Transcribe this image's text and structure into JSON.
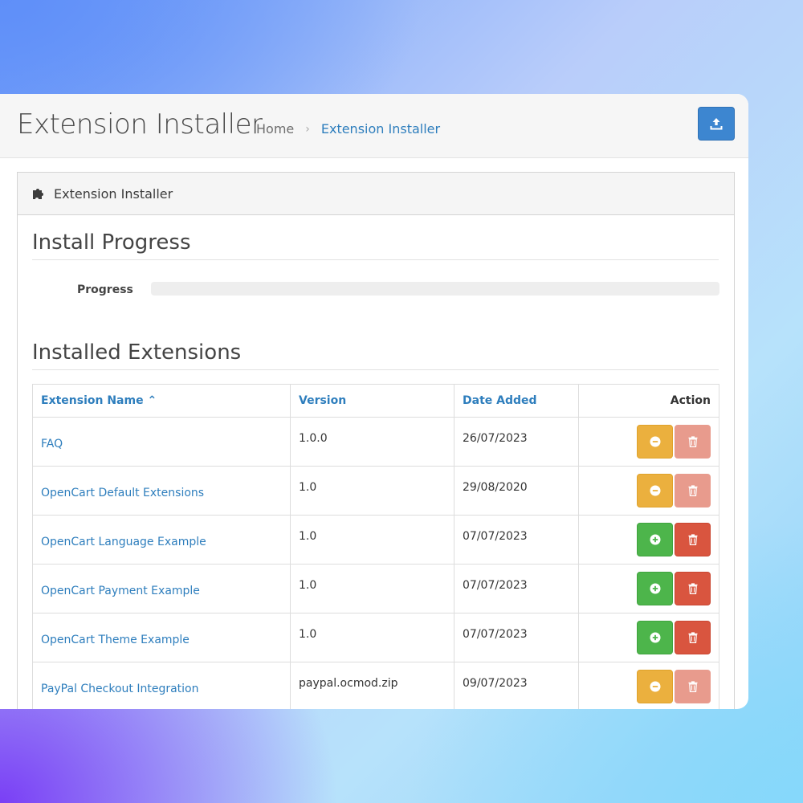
{
  "page": {
    "title": "Extension Installer",
    "breadcrumb": [
      {
        "label": "Home"
      },
      {
        "label": "Extension Installer"
      }
    ],
    "upload_icon": "upload-icon"
  },
  "panel": {
    "heading": "Extension Installer",
    "heading_icon": "puzzle-piece-icon"
  },
  "progress": {
    "section_title": "Install Progress",
    "label": "Progress",
    "value_percent": 0
  },
  "installed": {
    "section_title": "Installed Extensions",
    "columns": {
      "name": "Extension Name",
      "version": "Version",
      "date": "Date Added",
      "action": "Action"
    },
    "rows": [
      {
        "name": "FAQ",
        "version": "1.0.0",
        "date": "26/07/2023",
        "installed": true,
        "deletable": false
      },
      {
        "name": "OpenCart Default Extensions",
        "version": "1.0",
        "date": "29/08/2020",
        "installed": true,
        "deletable": false
      },
      {
        "name": "OpenCart Language Example",
        "version": "1.0",
        "date": "07/07/2023",
        "installed": false,
        "deletable": true
      },
      {
        "name": "OpenCart Payment Example",
        "version": "1.0",
        "date": "07/07/2023",
        "installed": false,
        "deletable": true
      },
      {
        "name": "OpenCart Theme Example",
        "version": "1.0",
        "date": "07/07/2023",
        "installed": false,
        "deletable": true
      },
      {
        "name": "PayPal Checkout Integration",
        "version": "paypal.ocmod.zip",
        "date": "09/07/2023",
        "installed": true,
        "deletable": false
      }
    ]
  },
  "colors": {
    "link": "#2e7ebd",
    "primary": "#3d86d0",
    "warning": "#ebb03e",
    "success": "#4db54b",
    "danger": "#d9553f",
    "danger_disabled": "#e89b8d"
  }
}
